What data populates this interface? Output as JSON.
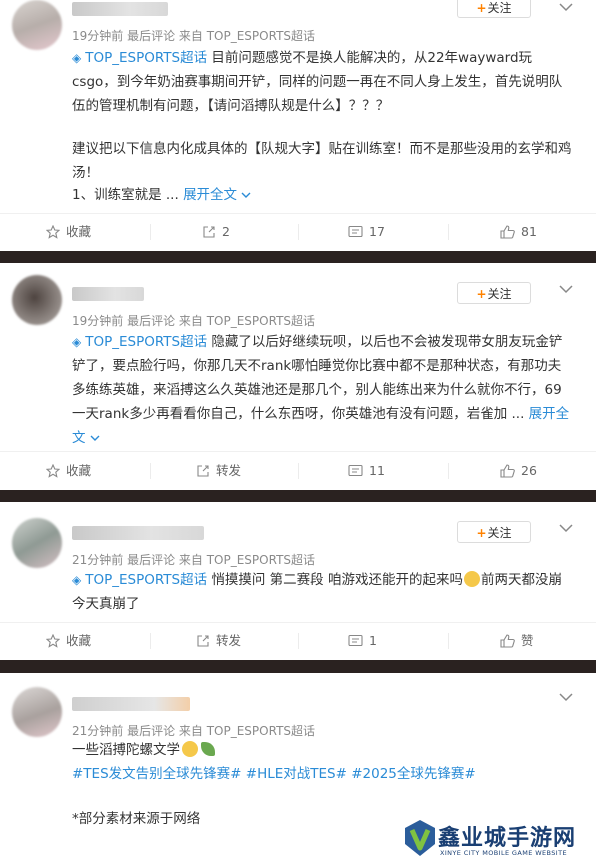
{
  "follow_label": "关注",
  "posts": [
    {
      "meta": "19分钟前 最后评论 来自 TOP_ESPORTS超话",
      "topic": "TOP_ESPORTS超话",
      "text": "目前问题感觉不是换人能解决的，从22年wayward玩csgo，到今年奶油赛事期间开铲，同样的问题一再在不同人身上发生，首先说明队伍的管理机制有问题，【请问滔搏队规是什么】？？？",
      "text2": "建议把以下信息内化成具体的【队规大字】贴在训练室！而不是那些没用的玄学和鸡汤！",
      "text3": "1、训练室就是 ...",
      "more": "展开全文",
      "actions": {
        "fav": "收藏",
        "repost": "2",
        "comment": "17",
        "like": "81"
      }
    },
    {
      "meta": "19分钟前 最后评论 来自 TOP_ESPORTS超话",
      "topic": "TOP_ESPORTS超话",
      "text": "隐藏了以后好继续玩呗，以后也不会被发现带女朋友玩金铲铲了，要点脸行吗，你那几天不rank哪怕睡觉你比赛中都不是那种状态，有那功夫多练练英雄，来滔搏这么久英雄池还是那几个，别人能练出来为什么就你不行，69一天rank多少再看看你自己，什么东西呀，你英雄池有没有问题，岩雀加 ...",
      "more": "展开全文",
      "actions": {
        "fav": "收藏",
        "repost": "转发",
        "comment": "11",
        "like": "26"
      }
    },
    {
      "meta": "21分钟前 最后评论 来自 TOP_ESPORTS超话",
      "topic": "TOP_ESPORTS超话",
      "text": "悄摸摸问 第二赛段 咱游戏还能开的起来吗",
      "text_after": "前两天都没崩 今天真崩了",
      "actions": {
        "fav": "收藏",
        "repost": "转发",
        "comment": "1",
        "like": "赞"
      }
    },
    {
      "meta": "21分钟前 最后评论 来自 TOP_ESPORTS超话",
      "text": "一些滔搏陀螺文学",
      "tags": "#TES发文告别全球先锋赛# #HLE对战TES# #2025全球先锋赛#",
      "note": "*部分素材来源于网络"
    }
  ],
  "watermark": {
    "title": "鑫业城手游网",
    "subtitle": "XINYE CITY MOBILE GAME WEBSITE"
  }
}
